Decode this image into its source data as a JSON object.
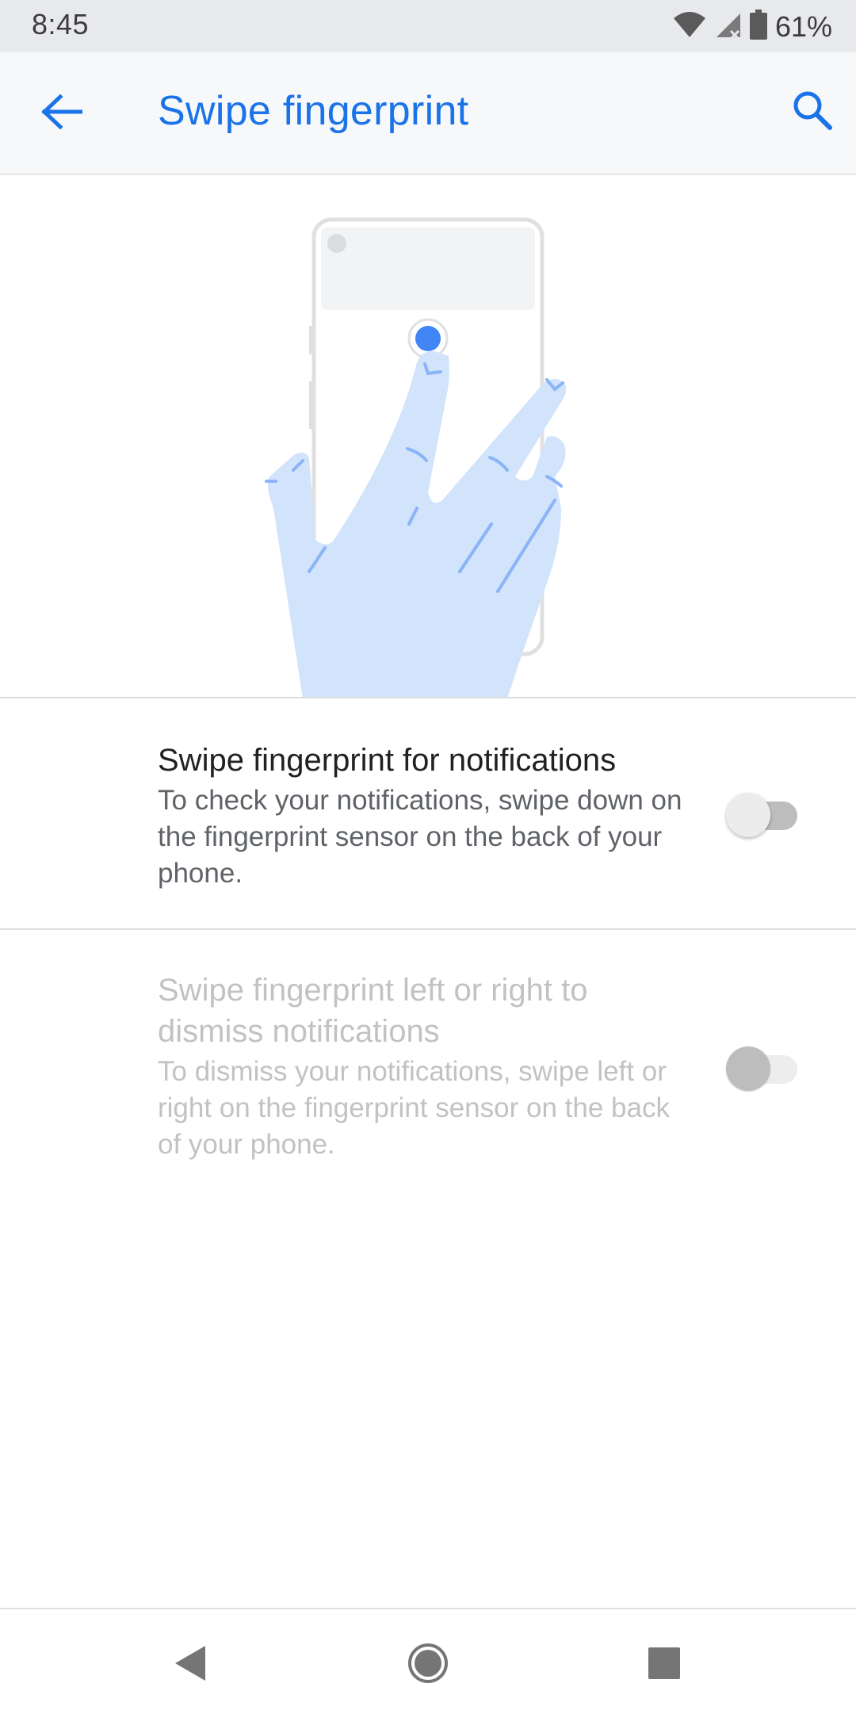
{
  "status_bar": {
    "time": "8:45",
    "battery_percent": "61%",
    "icons": [
      "wifi-icon",
      "cell-signal-icon",
      "battery-icon"
    ]
  },
  "app_bar": {
    "title": "Swipe fingerprint",
    "back_icon": "arrow-back-icon",
    "search_icon": "search-icon"
  },
  "illustration": {
    "icon": "hand-holding-phone-illustration",
    "accent_color": "#4285f4",
    "hand_color": "#d2e3fc"
  },
  "preferences": [
    {
      "title": "Swipe fingerprint for notifications",
      "summary": "To check your notifications, swipe down on the fingerprint sensor on the back of your phone.",
      "checked": false,
      "enabled": true
    },
    {
      "title": "Swipe fingerprint left or right to dismiss notifications",
      "summary": "To dismiss your notifications, swipe left or right on the fingerprint sensor on the back of your phone.",
      "checked": false,
      "enabled": false
    }
  ],
  "nav_bar": {
    "buttons": [
      "back-triangle-icon",
      "home-circle-icon",
      "recents-square-icon"
    ]
  },
  "colors": {
    "accent": "#1a73e8",
    "title_text": "#202124",
    "summary_text": "#5f6368",
    "disabled_text": "#c2c2c2"
  }
}
